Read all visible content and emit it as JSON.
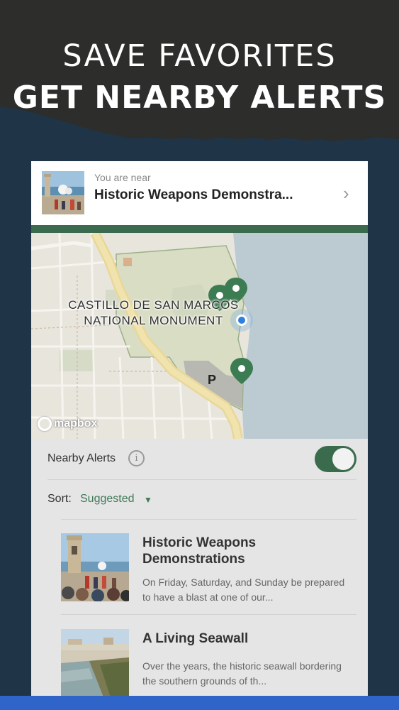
{
  "promo": {
    "line1": "SAVE FAVORITES",
    "line2": "GET NEARBY ALERTS"
  },
  "colors": {
    "header_dark": "#2d2d2b",
    "background_navy": "#1f3447",
    "accent_green": "#3c6a4e",
    "bottom_bar_blue": "#2f64c9"
  },
  "near_banner": {
    "caption": "You are near",
    "title": "Historic Weapons Demonstra...",
    "chevron_icon": "chevron-right-icon"
  },
  "map": {
    "label_line1": "CASTILLO DE SAN MARCOS",
    "label_line2": "NATIONAL MONUMENT",
    "parking_label": "P",
    "attribution": "mapbox"
  },
  "alerts": {
    "label": "Nearby Alerts",
    "info_icon": "info-icon",
    "toggle_on": true
  },
  "sort": {
    "label": "Sort:",
    "value": "Suggested"
  },
  "items": [
    {
      "title": "Historic Weapons Demonstrations",
      "description": "On Friday, Saturday, and Sunday be prepared to have a blast at one of our..."
    },
    {
      "title": "A Living Seawall",
      "description": "Over the years, the historic seawall bordering the southern grounds of th..."
    }
  ]
}
